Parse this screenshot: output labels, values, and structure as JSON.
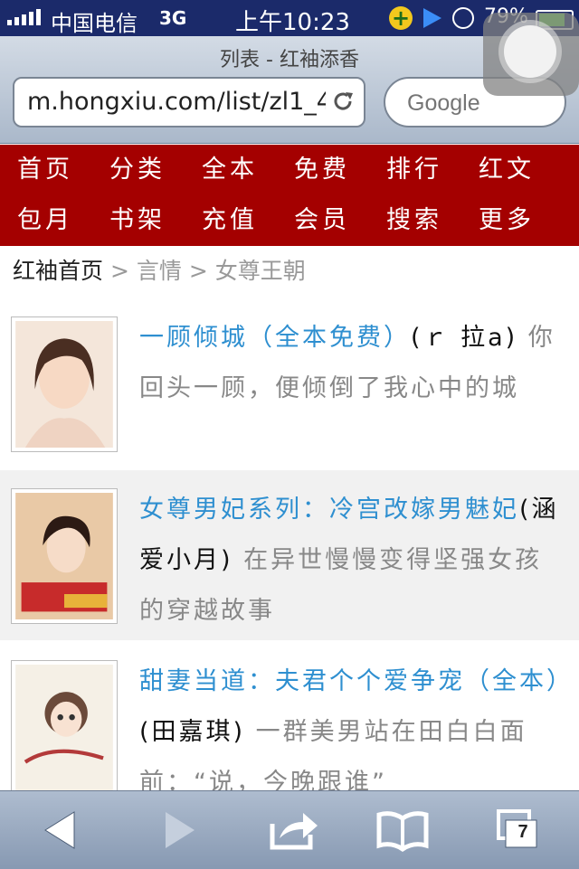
{
  "status_bar": {
    "carrier": "中国电信",
    "network": "3G",
    "time": "上午10:23",
    "battery": "79%"
  },
  "browser": {
    "page_title": "列表 - 红袖添香",
    "url": "m.hongxiu.com/list/zl1_4",
    "search_placeholder": "Google"
  },
  "nav": {
    "items": [
      "首页",
      "分类",
      "全本",
      "免费",
      "排行",
      "红文",
      "包月",
      "书架",
      "充值",
      "会员",
      "搜索",
      "更多"
    ]
  },
  "breadcrumb": {
    "home": "红袖首页",
    "sep1": ">",
    "category": "言情",
    "sep2": ">",
    "current": "女尊王朝"
  },
  "books": [
    {
      "title": "一顾倾城（全本免费）",
      "author": "(ｒ 拉a)",
      "description": "你回头一顾，便倾倒了我心中的城"
    },
    {
      "title": "女尊男妃系列：冷宫改嫁男魅妃",
      "author": "(涵爱小月)",
      "description": "在异世慢慢变得坚强女孩的穿越故事"
    },
    {
      "title": "甜妻当道：夫君个个爱争宠（全本）",
      "author": "(田嘉琪)",
      "description": "一群美男站在田白白面前：“说，今晚跟谁”"
    }
  ],
  "toolbar": {
    "tabs_count": "7"
  },
  "colors": {
    "nav_bg": "#a40000",
    "title_link": "#2e8fd0",
    "status_bar": "#1b2a6a"
  },
  "icons": [
    "signal-icon",
    "add-icon",
    "play-icon",
    "clock-icon",
    "battery-icon",
    "reload-icon",
    "back-icon",
    "forward-icon",
    "share-icon",
    "bookmarks-icon",
    "tabs-icon"
  ]
}
